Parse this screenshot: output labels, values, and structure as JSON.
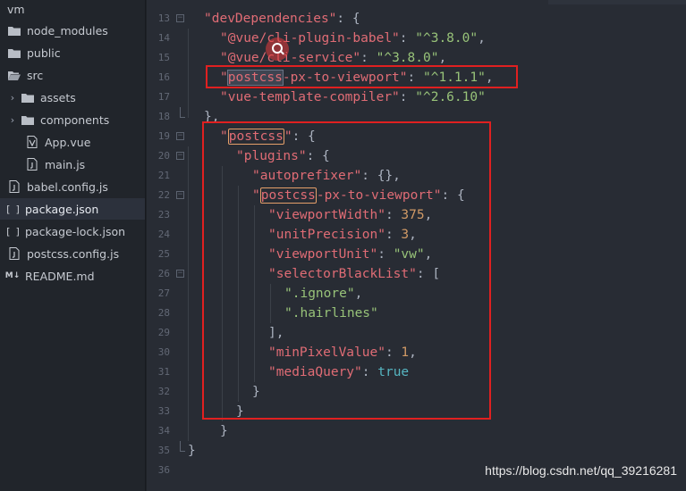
{
  "sidebar": {
    "root": {
      "label": "vm"
    },
    "items": [
      {
        "label": "node_modules",
        "type": "folder"
      },
      {
        "label": "public",
        "type": "folder"
      },
      {
        "label": "src",
        "type": "folder-open"
      },
      {
        "label": "assets",
        "type": "folder"
      },
      {
        "label": "components",
        "type": "folder"
      },
      {
        "label": "App.vue",
        "type": "vue-file"
      },
      {
        "label": "main.js",
        "type": "js-file"
      },
      {
        "label": "babel.config.js",
        "type": "js-file"
      },
      {
        "label": "package.json",
        "type": "json-file",
        "active": true
      },
      {
        "label": "package-lock.json",
        "type": "json-file"
      },
      {
        "label": "postcss.config.js",
        "type": "js-file"
      },
      {
        "label": "README.md",
        "type": "md-file"
      }
    ],
    "json_glyph": "[ ]",
    "md_glyph": "M↓"
  },
  "editor": {
    "line_numbers": [
      "13",
      "14",
      "15",
      "16",
      "17",
      "18",
      "19",
      "20",
      "21",
      "22",
      "23",
      "24",
      "25",
      "26",
      "27",
      "28",
      "29",
      "30",
      "31",
      "32",
      "33",
      "34",
      "35",
      "36"
    ],
    "tokens": {
      "devDependencies_key": "\"devDependencies\"",
      "babel_key": "\"@vue/cli-plugin-babel\"",
      "babel_val": "\"^3.8.0\"",
      "service_key": "\"@vue/cli-service\"",
      "service_val": "\"^3.8.0\"",
      "px2vw_key_quote": "\"",
      "px2vw_key_match": "postcss",
      "px2vw_key_rest": "-px-to-viewport\"",
      "px2vw_val": "\"^1.1.1\"",
      "compiler_key": "\"vue-template-compiler\"",
      "compiler_val": "\"^2.6.10\"",
      "close_brace_comma": "},",
      "postcss_quote_open": "\"",
      "postcss_match": "postcss",
      "postcss_quote_close": "\"",
      "plugins_key": "\"plugins\"",
      "autoprefixer_key": "\"autoprefixer\"",
      "autoprefixer_val": "{},",
      "plugin_px2vw_quote_open": "\"",
      "plugin_px2vw_match": "postcss",
      "plugin_px2vw_rest": "-px-to-viewport\"",
      "viewportWidth_key": "\"viewportWidth\"",
      "viewportWidth_val": "375",
      "unitPrecision_key": "\"unitPrecision\"",
      "unitPrecision_val": "3",
      "viewportUnit_key": "\"viewportUnit\"",
      "viewportUnit_val": "\"vw\"",
      "selectorBlackList_key": "\"selectorBlackList\"",
      "ignore_val": "\".ignore\"",
      "hairlines_val": "\".hairlines\"",
      "array_close": "],",
      "minPixelValue_key": "\"minPixelValue\"",
      "minPixelValue_val": "1",
      "mediaQuery_key": "\"mediaQuery\"",
      "mediaQuery_val": "true"
    },
    "punct": {
      "colon_open": ": {",
      "colon_sp": ": ",
      "comma": ",",
      "colon_bracket": ": [",
      "close": "}"
    }
  },
  "watermark": "https://blog.csdn.net/qq_39216281",
  "colors": {
    "key": "#e06c75",
    "string": "#98c379",
    "number": "#d19a66",
    "boolean": "#56b6c2",
    "annotation_box": "#e02020"
  }
}
